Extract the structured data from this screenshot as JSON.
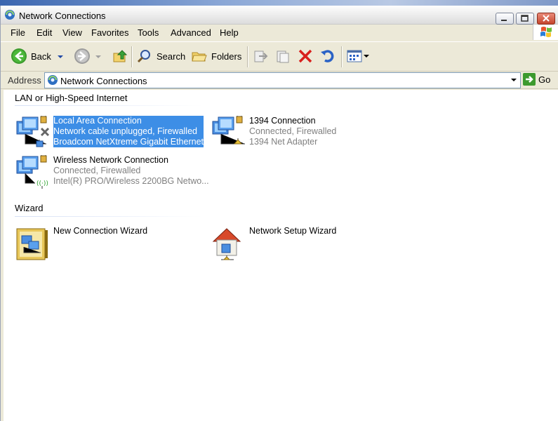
{
  "window": {
    "title": "Network Connections"
  },
  "menu": [
    "File",
    "Edit",
    "View",
    "Favorites",
    "Tools",
    "Advanced",
    "Help"
  ],
  "toolbar": {
    "back": "Back",
    "search": "Search",
    "folders": "Folders"
  },
  "address": {
    "label": "Address",
    "value": "Network Connections",
    "go": "Go"
  },
  "groups": {
    "lan": {
      "title": "LAN or High-Speed Internet",
      "items": [
        {
          "name": "Local Area Connection",
          "status": "Network cable unplugged, Firewalled",
          "device": "Broadcom NetXtreme Gigabit Ethernet",
          "selected": true
        },
        {
          "name": "1394 Connection",
          "status": "Connected, Firewalled",
          "device": "1394 Net Adapter"
        },
        {
          "name": "Wireless Network Connection",
          "status": "Connected, Firewalled",
          "device": "Intel(R) PRO/Wireless 2200BG Netwo..."
        }
      ]
    },
    "wizard": {
      "title": "Wizard",
      "items": [
        {
          "name": "New Connection Wizard"
        },
        {
          "name": "Network Setup Wizard"
        }
      ]
    }
  },
  "colors": {
    "selection": "#3d8ee6",
    "status_text": "#808080"
  }
}
